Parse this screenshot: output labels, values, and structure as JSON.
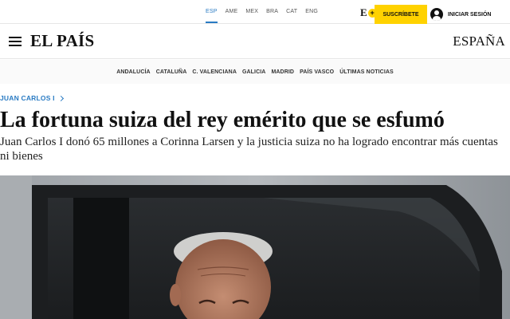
{
  "editions": [
    "ESP",
    "AME",
    "MEX",
    "BRA",
    "CAT",
    "ENG"
  ],
  "active_edition": "ESP",
  "eplus": {
    "letter": "E",
    "plus": "+"
  },
  "subscribe_label": "SUSCRÍBETE",
  "login_label": "INICIAR SESIÓN",
  "masthead": {
    "logo": "EL PAÍS",
    "section": "ESPAÑA"
  },
  "regions": [
    "ANDALUCÍA",
    "CATALUÑA",
    "C. VALENCIANA",
    "GALICIA",
    "MADRID",
    "PAÍS VASCO",
    "ÚLTIMAS NOTICIAS"
  ],
  "article": {
    "tag": "JUAN CARLOS I",
    "headline": "La fortuna suiza del rey emérito que se esfumó",
    "subheadline": "Juan Carlos I donó 65 millones a Corinna Larsen y la justicia suiza no ha logrado encontrar más cuentas ni bienes"
  },
  "colors": {
    "accent_blue": "#2a7bc3",
    "subscribe_yellow": "#ffd200",
    "text": "#111111"
  }
}
